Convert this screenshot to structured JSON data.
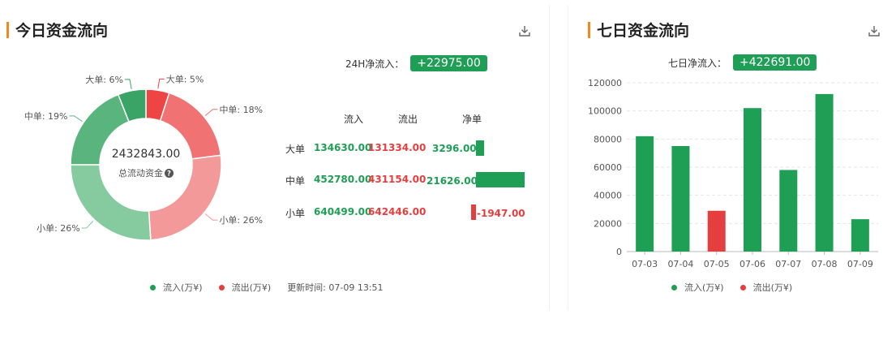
{
  "colors": {
    "inflow": "#1f9e56",
    "outflow": "#e53e3e",
    "accent": "#f7861c"
  },
  "left": {
    "title": "今日资金流向",
    "download_icon": "download-icon",
    "net_label": "24H净流入：",
    "net_value": "+22975.00",
    "donut_total": "2432843.00",
    "donut_caption": "总流动资金",
    "help_icon": "question-circle-icon",
    "table": {
      "headers": [
        "流入",
        "流出",
        "净单"
      ],
      "rows": [
        {
          "label": "大单",
          "in": "134630.00",
          "out": "131334.00",
          "net": "3296.00"
        },
        {
          "label": "中单",
          "in": "452780.00",
          "out": "431154.00",
          "net": "21626.00"
        },
        {
          "label": "小单",
          "in": "640499.00",
          "out": "642446.00",
          "net": "-1947.00"
        }
      ]
    },
    "legend": {
      "in": "流入(万¥)",
      "out": "流出(万¥)"
    },
    "update_time": "更新时间: 07-09 13:51"
  },
  "right": {
    "title": "七日资金流向",
    "download_icon": "download-icon",
    "net_label": "七日净流入：",
    "net_value": "+422691.00",
    "legend": {
      "in": "流入(万¥)",
      "out": "流出(万¥)"
    }
  },
  "chart_data": [
    {
      "type": "pie",
      "variant": "donut",
      "slices": [
        {
          "label": "大单: 5%",
          "value": 5,
          "flow": "out",
          "color": "#ef4444"
        },
        {
          "label": "中单: 18%",
          "value": 18,
          "flow": "out",
          "color": "#f07272"
        },
        {
          "label": "小单: 26%",
          "value": 26,
          "flow": "out",
          "color": "#f49999"
        },
        {
          "label": "小单: 26%",
          "value": 26,
          "flow": "in",
          "color": "#86cba0"
        },
        {
          "label": "中单: 19%",
          "value": 19,
          "flow": "in",
          "color": "#5ab47e"
        },
        {
          "label": "大单: 6%",
          "value": 6,
          "flow": "in",
          "color": "#3aa366"
        }
      ]
    },
    {
      "type": "bar",
      "orientation": "horizontal",
      "categories": [
        "大单",
        "中单",
        "小单"
      ],
      "values": [
        3296.0,
        21626.0,
        -1947.0
      ]
    },
    {
      "type": "bar",
      "categories": [
        "07-03",
        "07-04",
        "07-05",
        "07-06",
        "07-07",
        "07-08",
        "07-09"
      ],
      "values": [
        82000,
        75000,
        29000,
        102000,
        58000,
        112000,
        23000
      ],
      "directions": [
        "in",
        "in",
        "out",
        "in",
        "in",
        "in",
        "in"
      ],
      "ylim": [
        0,
        120000
      ],
      "yticks": [
        0,
        20000,
        40000,
        60000,
        80000,
        100000,
        120000
      ],
      "grid": true
    }
  ]
}
